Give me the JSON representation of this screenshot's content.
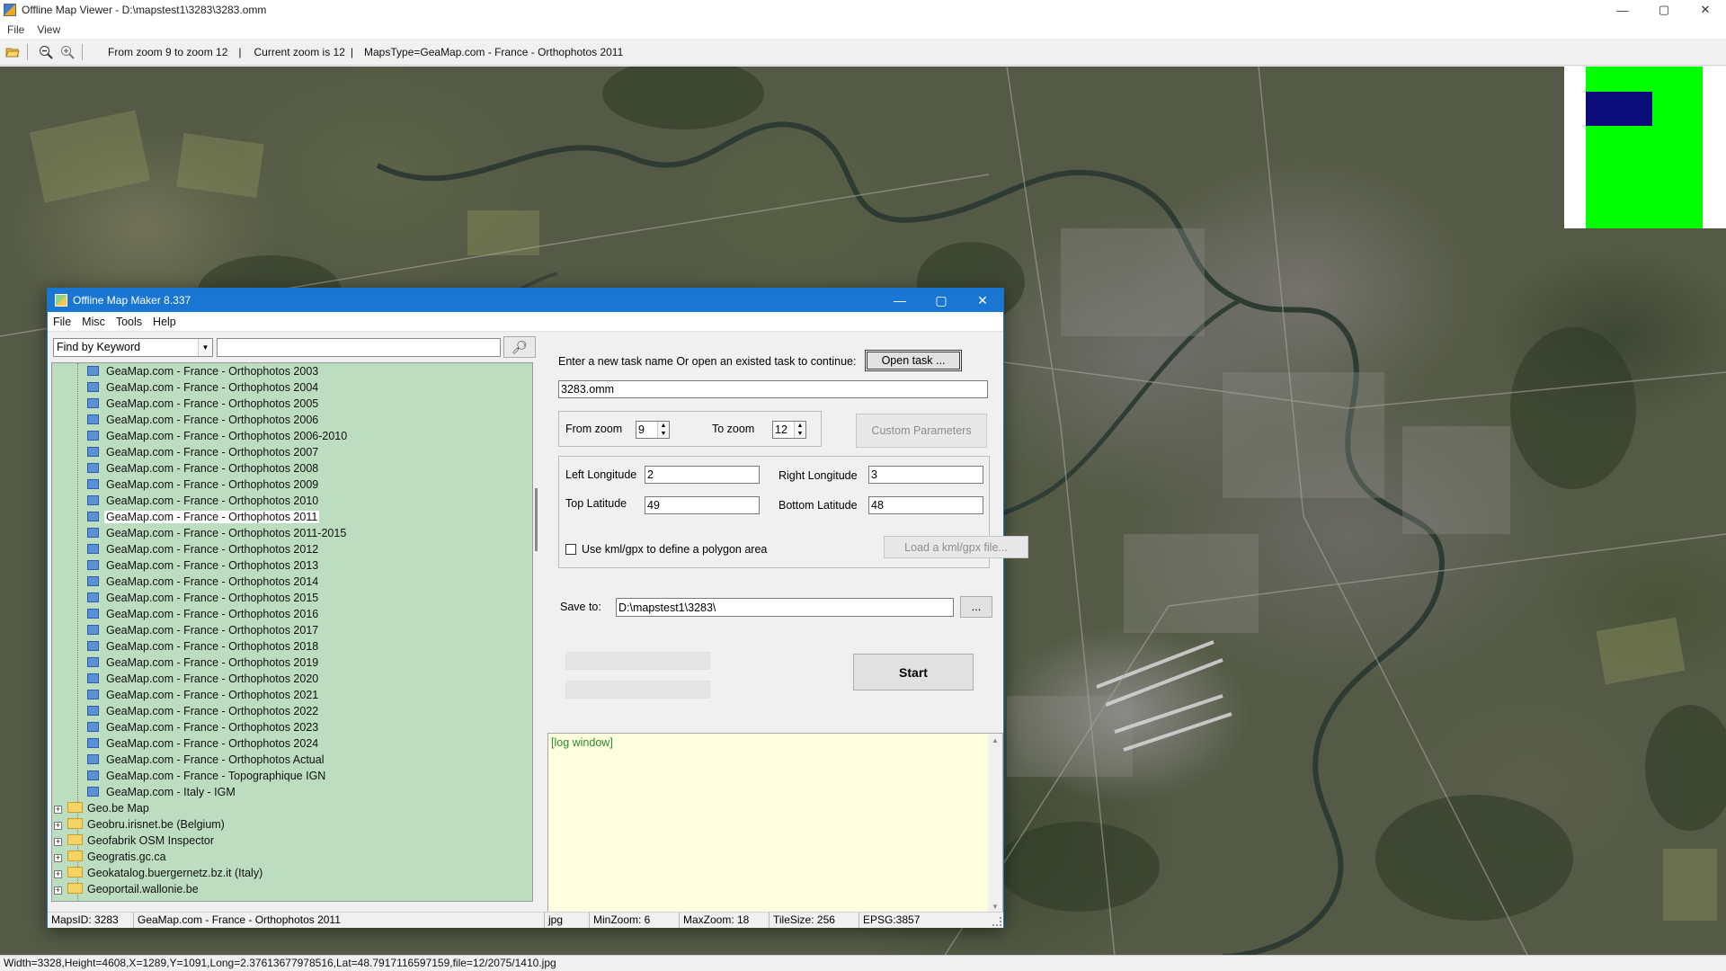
{
  "window": {
    "title": "Offline Map Viewer - D:\\mapstest1\\3283\\3283.omm",
    "controls": {
      "minimize": "—",
      "maximize": "▢",
      "close": "✕"
    },
    "menu": [
      "File",
      "View"
    ]
  },
  "toolbar": {
    "zoom_range": "From zoom 9 to zoom 12",
    "sep1": "|",
    "current_zoom": "Current zoom is 12",
    "sep2": "|",
    "maps_type": "MapsType=GeaMap.com - France - Orthophotos 2011",
    "icons": [
      "open-folder-icon",
      "zoom-out-icon",
      "zoom-in-icon"
    ]
  },
  "status_bar": {
    "text": "Width=3328,Height=4608,X=1289,Y=1091,Long=2.37613677978516,Lat=48.7917116597159,file=12/2075/1410.jpg"
  },
  "minimap": {
    "area_color": "#00ff00",
    "view_color": "#0b0b7a"
  },
  "dialog": {
    "title": "Offline Map Maker 8.337",
    "controls": {
      "minimize": "—",
      "maximize": "▢",
      "close": "✕"
    },
    "menu": [
      "File",
      "Misc",
      "Tools",
      "Help"
    ],
    "search": {
      "mode": "Find by Keyword",
      "keyword": ""
    },
    "tree": {
      "leaves": [
        "GeaMap.com - France - Orthophotos 2003",
        "GeaMap.com - France - Orthophotos 2004",
        "GeaMap.com - France - Orthophotos 2005",
        "GeaMap.com - France - Orthophotos 2006",
        "GeaMap.com - France - Orthophotos 2006-2010",
        "GeaMap.com - France - Orthophotos 2007",
        "GeaMap.com - France - Orthophotos 2008",
        "GeaMap.com - France - Orthophotos 2009",
        "GeaMap.com - France - Orthophotos 2010",
        "GeaMap.com - France - Orthophotos 2011",
        "GeaMap.com - France - Orthophotos 2011-2015",
        "GeaMap.com - France - Orthophotos 2012",
        "GeaMap.com - France - Orthophotos 2013",
        "GeaMap.com - France - Orthophotos 2014",
        "GeaMap.com - France - Orthophotos 2015",
        "GeaMap.com - France - Orthophotos 2016",
        "GeaMap.com - France - Orthophotos 2017",
        "GeaMap.com - France - Orthophotos 2018",
        "GeaMap.com - France - Orthophotos 2019",
        "GeaMap.com - France - Orthophotos 2020",
        "GeaMap.com - France - Orthophotos 2021",
        "GeaMap.com - France - Orthophotos 2022",
        "GeaMap.com - France - Orthophotos 2023",
        "GeaMap.com - France - Orthophotos 2024",
        "GeaMap.com - France - Orthophotos Actual",
        "GeaMap.com - France - Topographique IGN",
        "GeaMap.com - Italy - IGM"
      ],
      "selected": "GeaMap.com - France - Orthophotos 2011",
      "folders": [
        "Geo.be Map",
        "Geobru.irisnet.be (Belgium)",
        "Geofabrik OSM Inspector",
        "Geogratis.gc.ca",
        "Geokatalog.buergernetz.bz.it (Italy)",
        "Geoportail.wallonie.be"
      ],
      "tree_bg": "#bcddbf"
    },
    "task": {
      "prompt": "Enter a new task name Or open an existed task to continue:",
      "open_button": "Open task ...",
      "name": "3283.omm"
    },
    "zoom": {
      "from_label": "From zoom",
      "from_value": "9",
      "to_label": "To zoom",
      "to_value": "12",
      "custom_button": "Custom Parameters"
    },
    "area": {
      "left_lon_label": "Left Longitude",
      "left_lon": "2",
      "right_lon_label": "Right Longitude",
      "right_lon": "3",
      "top_lat_label": "Top Latitude",
      "top_lat": "49",
      "bottom_lat_label": "Bottom Latitude",
      "bottom_lat": "48",
      "kml_label": "Use kml/gpx to define a polygon area",
      "kml_checked": false,
      "load_kml_button": "Load a kml/gpx file..."
    },
    "save": {
      "label": "Save to:",
      "path": "D:\\mapstest1\\3283\\",
      "browse_button": "..."
    },
    "start_button": "Start",
    "log": {
      "text": "[log window]",
      "bg": "#ffffe0"
    },
    "status": {
      "maps_id": "MapsID: 3283",
      "map_name": "GeaMap.com - France - Orthophotos 2011",
      "format": "jpg",
      "min_zoom": "MinZoom: 6",
      "max_zoom": "MaxZoom: 18",
      "tile_size": "TileSize: 256",
      "epsg": "EPSG:3857"
    }
  }
}
